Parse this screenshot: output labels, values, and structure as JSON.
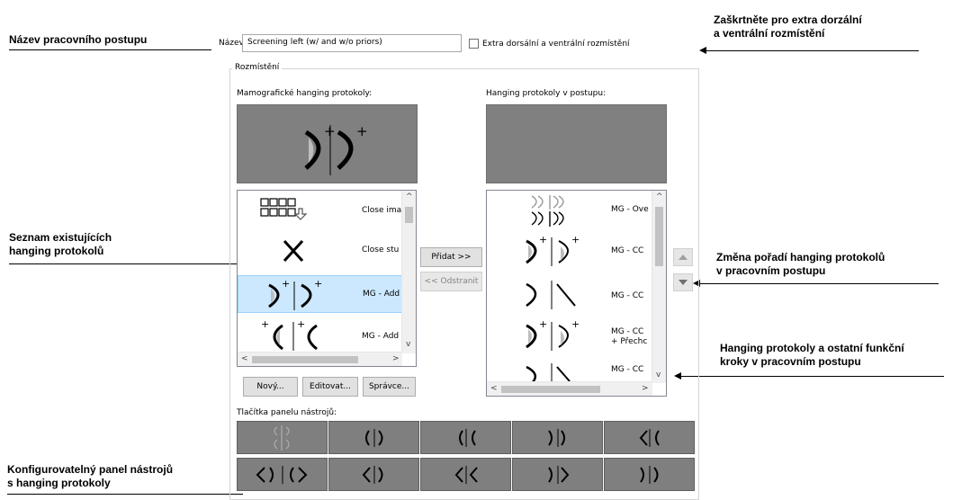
{
  "callouts": {
    "workflow_name": "Název pracovního postupu",
    "extra_check": [
      "Zaškrtněte pro extra dorzální",
      "a ventrální rozmístění"
    ],
    "existing_list": [
      "Seznam existujících",
      "hanging protokolů"
    ],
    "reorder": [
      "Změna pořadí hanging protokolů",
      "v pracovním postupu"
    ],
    "in_workflow": [
      "Hanging protokoly a ostatní funkční",
      "kroky v pracovním postupu"
    ],
    "toolbar": [
      "Konfigurovatelný panel nástrojů",
      "s hanging protokoly"
    ]
  },
  "form": {
    "name_label": "Název:",
    "name_value": "Screening left (w/ and w/o priors)",
    "extra_checkbox_label": "Extra dorsální a ventrální rozmístění",
    "extra_checked": false,
    "layout_group": "Rozmístění",
    "mammo_protocols_label": "Mamografické hanging protokoly:",
    "workflow_protocols_label": "Hanging protokoly v postupu:",
    "add_button": "Přidat >>",
    "remove_button": "<< Odstranit",
    "new_button": "Nový...",
    "edit_button": "Editovat...",
    "manager_button": "Správce...",
    "toolbar_label": "Tlačítka panelu nástrojů:"
  },
  "left_list": [
    {
      "icon": "grid-close-images-icon",
      "label": "Close ima"
    },
    {
      "icon": "x-close-study-icon",
      "label": "Close stu"
    },
    {
      "icon": "mg-breast-pair-plus-icon",
      "label": "MG - Add",
      "selected": true
    },
    {
      "icon": "mg-breast-pair-plus-left-icon",
      "label": "MG - Add"
    }
  ],
  "right_list": [
    {
      "icon": "mg-overview-icon",
      "label": "MG - Ove"
    },
    {
      "icon": "mg-cc-plus-icon",
      "label": "MG - CC"
    },
    {
      "icon": "mg-cc-icon",
      "label": "MG - CC"
    },
    {
      "icon": "mg-cc-transition-icon",
      "label": "MG - CC",
      "sublabel": "+ Přechc"
    },
    {
      "icon": "mg-cc-partial-icon",
      "label": "MG - CC"
    }
  ],
  "colors": {
    "preview_bg": "#808080",
    "selected_row": "#cce8ff",
    "toolbar_bg": "#7f7f7f"
  }
}
